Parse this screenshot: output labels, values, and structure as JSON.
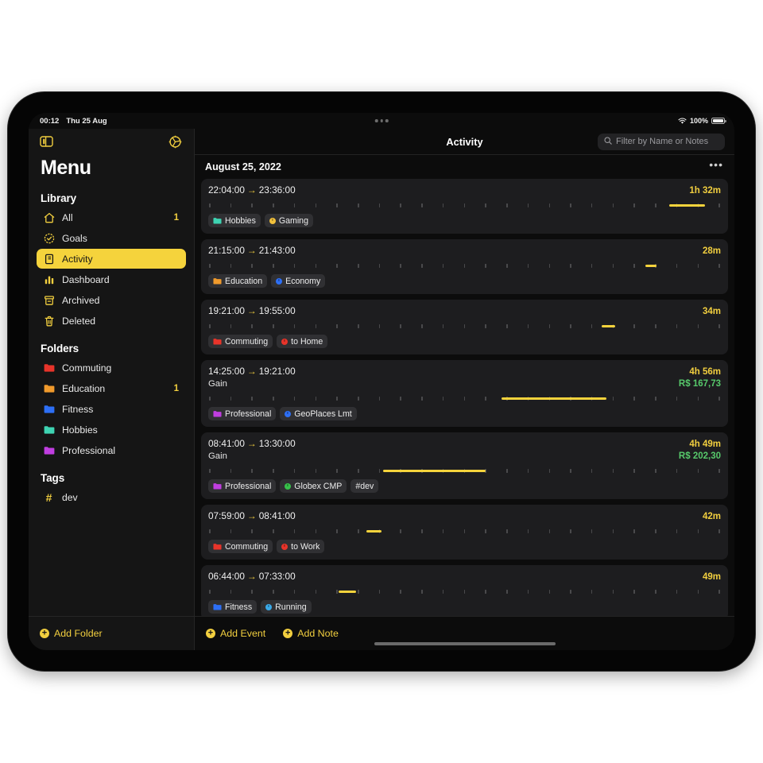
{
  "status_bar": {
    "time": "00:12",
    "date": "Thu 25 Aug",
    "battery_percent": "100%",
    "wifi_icon": "wifi-icon",
    "battery_icon": "battery-icon",
    "multitask_icon": "multitask-dots-icon"
  },
  "sidebar": {
    "toggle_icon": "sidebar-toggle-icon",
    "settings_icon": "gear-icon",
    "title": "Menu",
    "sections": [
      {
        "heading": "Library",
        "items": [
          {
            "label": "All",
            "icon": "home-icon",
            "count": "1",
            "active": false
          },
          {
            "label": "Goals",
            "icon": "goal-badge-icon",
            "count": "",
            "active": false
          },
          {
            "label": "Activity",
            "icon": "document-icon",
            "count": "",
            "active": true
          },
          {
            "label": "Dashboard",
            "icon": "bar-chart-icon",
            "count": "",
            "active": false
          },
          {
            "label": "Archived",
            "icon": "archive-icon",
            "count": "",
            "active": false
          },
          {
            "label": "Deleted",
            "icon": "trash-icon",
            "count": "",
            "active": false
          }
        ]
      },
      {
        "heading": "Folders",
        "items": [
          {
            "label": "Commuting",
            "icon": "folder-icon",
            "color": "#e8342a",
            "count": "",
            "active": false
          },
          {
            "label": "Education",
            "icon": "folder-icon",
            "color": "#f09a2c",
            "count": "1",
            "active": false
          },
          {
            "label": "Fitness",
            "icon": "folder-icon",
            "color": "#2d6ff5",
            "count": "",
            "active": false
          },
          {
            "label": "Hobbies",
            "icon": "folder-icon",
            "color": "#3ed3b2",
            "count": "",
            "active": false
          },
          {
            "label": "Professional",
            "icon": "folder-icon",
            "color": "#c03ee0",
            "count": "",
            "active": false
          }
        ]
      },
      {
        "heading": "Tags",
        "items": [
          {
            "label": "dev",
            "icon": "hash-icon",
            "count": "",
            "active": false
          }
        ]
      }
    ],
    "add_folder_label": "Add Folder"
  },
  "main": {
    "title": "Activity",
    "search": {
      "placeholder": "Filter by Name or Notes",
      "value": "",
      "icon": "search-icon"
    },
    "day_header": {
      "label": "August 25, 2022",
      "menu_icon": "ellipsis-icon"
    },
    "add_event_label": "Add Event",
    "add_note_label": "Add Note",
    "events": [
      {
        "start": "22:04:00",
        "end": "23:36:00",
        "arrow": "→",
        "duration": "1h 32m",
        "note": "",
        "gain": "",
        "bar": {
          "left_pct": 90.0,
          "width_pct": 7.0
        },
        "pills": [
          {
            "label": "Hobbies",
            "type": "folder",
            "color": "#3ed3b2"
          },
          {
            "label": "Gaming",
            "type": "dot",
            "color": "#f2c13c"
          }
        ]
      },
      {
        "start": "21:15:00",
        "end": "21:43:00",
        "arrow": "→",
        "duration": "28m",
        "note": "",
        "gain": "",
        "bar": {
          "left_pct": 85.4,
          "width_pct": 2.2
        },
        "pills": [
          {
            "label": "Education",
            "type": "folder",
            "color": "#f09a2c"
          },
          {
            "label": "Economy",
            "type": "dot",
            "color": "#2d6ff5"
          }
        ]
      },
      {
        "start": "19:21:00",
        "end": "19:55:00",
        "arrow": "→",
        "duration": "34m",
        "note": "",
        "gain": "",
        "bar": {
          "left_pct": 76.8,
          "width_pct": 2.6
        },
        "pills": [
          {
            "label": "Commuting",
            "type": "folder",
            "color": "#e8342a"
          },
          {
            "label": "to Home",
            "type": "dot",
            "color": "#e8342a"
          }
        ]
      },
      {
        "start": "14:25:00",
        "end": "19:21:00",
        "arrow": "→",
        "duration": "4h 56m",
        "note": "Gain",
        "gain": "R$ 167,73",
        "bar": {
          "left_pct": 57.3,
          "width_pct": 20.5
        },
        "pills": [
          {
            "label": "Professional",
            "type": "folder",
            "color": "#c03ee0"
          },
          {
            "label": "GeoPlaces Lmt",
            "type": "dot",
            "color": "#2d6ff5"
          }
        ]
      },
      {
        "start": "08:41:00",
        "end": "13:30:00",
        "arrow": "→",
        "duration": "4h 49m",
        "note": "Gain",
        "gain": "R$ 202,30",
        "bar": {
          "left_pct": 34.0,
          "width_pct": 20.1
        },
        "pills": [
          {
            "label": "Professional",
            "type": "folder",
            "color": "#c03ee0"
          },
          {
            "label": "Globex CMP",
            "type": "dot",
            "color": "#37c24a"
          },
          {
            "label": "#dev",
            "type": "tag",
            "color": "#8c8c8c"
          }
        ]
      },
      {
        "start": "07:59:00",
        "end": "08:41:00",
        "arrow": "→",
        "duration": "42m",
        "note": "",
        "gain": "",
        "bar": {
          "left_pct": 30.8,
          "width_pct": 2.9
        },
        "pills": [
          {
            "label": "Commuting",
            "type": "folder",
            "color": "#e8342a"
          },
          {
            "label": "to Work",
            "type": "dot",
            "color": "#e8342a"
          }
        ]
      },
      {
        "start": "06:44:00",
        "end": "07:33:00",
        "arrow": "→",
        "duration": "49m",
        "note": "",
        "gain": "",
        "bar": {
          "left_pct": 25.4,
          "width_pct": 3.4
        },
        "pills": [
          {
            "label": "Fitness",
            "type": "folder",
            "color": "#2d6ff5"
          },
          {
            "label": "Running",
            "type": "dot",
            "color": "#3aa9e8"
          }
        ]
      }
    ]
  },
  "theme": {
    "accent": "#f5d33c",
    "gain_green": "#57c96b",
    "screen_bg": "#0c0c0c",
    "sidebar_bg": "#151515",
    "card_bg": "#1d1d1f"
  }
}
